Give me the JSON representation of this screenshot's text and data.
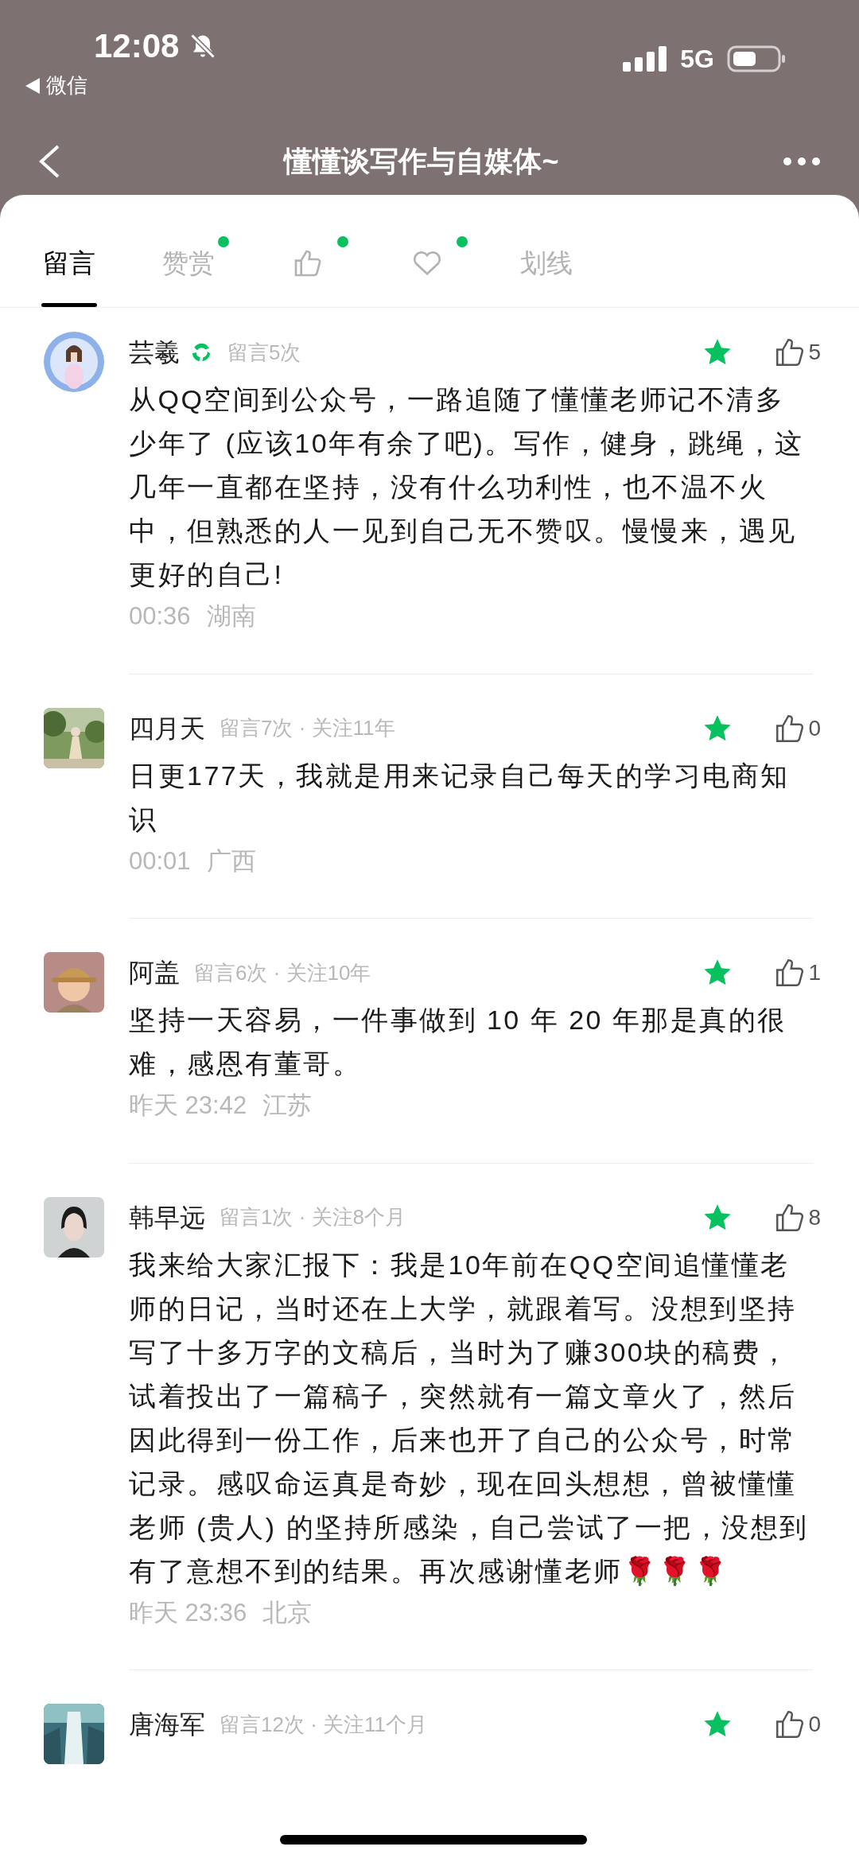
{
  "status_bar": {
    "time": "12:08",
    "back_app": "微信",
    "network": "5G"
  },
  "header": {
    "title": "懂懂谈写作与自媒体~"
  },
  "tabs": [
    {
      "kind": "text",
      "label": "留言",
      "selected": true,
      "badge": false
    },
    {
      "kind": "text",
      "label": "赞赏",
      "selected": false,
      "badge": true
    },
    {
      "kind": "thumb",
      "selected": false,
      "badge": true
    },
    {
      "kind": "heart",
      "selected": false,
      "badge": true
    },
    {
      "kind": "text",
      "label": "划线",
      "selected": false,
      "badge": false
    }
  ],
  "comments": [
    {
      "name": "芸羲",
      "verified": true,
      "meta": "留言5次",
      "featured": true,
      "likes": "5",
      "text": "从QQ空间到公众号，一路追随了懂懂老师记不清多少年了 (应该10年有余了吧)。写作，健身，跳绳，这几年一直都在坚持，没有什么功利性，也不温不火中，但熟悉的人一见到自己无不赞叹。慢慢来，遇见更好的自己!",
      "time": "00:36",
      "place": "湖南"
    },
    {
      "name": "四月天",
      "verified": false,
      "meta": "留言7次 · 关注11年",
      "featured": true,
      "likes": "0",
      "text": "日更177天，我就是用来记录自己每天的学习电商知识",
      "time": "00:01",
      "place": "广西"
    },
    {
      "name": "阿盖",
      "verified": false,
      "meta": "留言6次 · 关注10年",
      "featured": true,
      "likes": "1",
      "text": "坚持一天容易，一件事做到 10 年 20 年那是真的很难，感恩有董哥。",
      "time": "昨天 23:42",
      "place": "江苏"
    },
    {
      "name": "韩早远",
      "verified": false,
      "meta": "留言1次 · 关注8个月",
      "featured": true,
      "likes": "8",
      "text": "我来给大家汇报下：我是10年前在QQ空间追懂懂老师的日记，当时还在上大学，就跟着写。没想到坚持写了十多万字的文稿后，当时为了赚300块的稿费，试着投出了一篇稿子，突然就有一篇文章火了，然后因此得到一份工作，后来也开了自己的公众号，时常记录。感叹命运真是奇妙，现在回头想想，曾被懂懂老师 (贵人) 的坚持所感染，自己尝试了一把，没想到有了意想不到的结果。再次感谢懂老师🌹🌹🌹",
      "time": "昨天 23:36",
      "place": "北京"
    },
    {
      "name": "唐海军",
      "verified": false,
      "meta": "留言12次 · 关注11个月",
      "featured": true,
      "likes": "0"
    }
  ]
}
